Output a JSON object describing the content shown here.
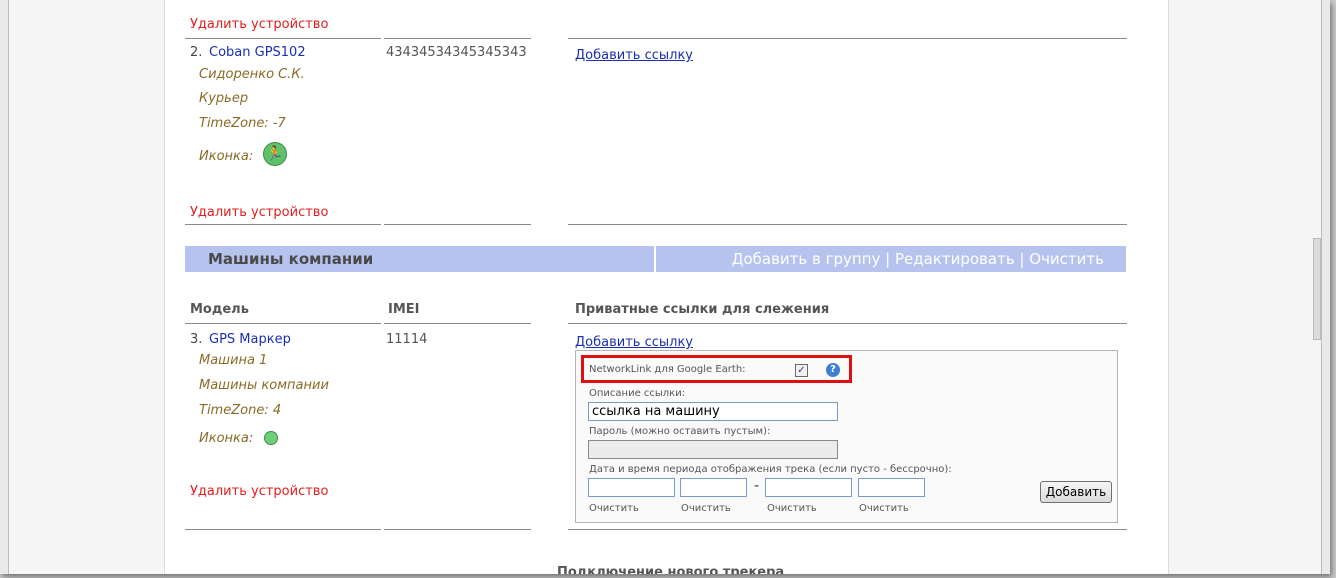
{
  "device_prev": {
    "delete_label_top": "Удалить устройство",
    "index": "2.",
    "model": "Coban GPS102",
    "imei": "43434534345345343",
    "owner": "Сидоренко С.К.",
    "group": "Курьер",
    "timezone": "TimeZone: -7",
    "icon_label": "Иконка:",
    "icon_name": "runner-icon",
    "add_link": "Добавить ссылку",
    "delete_label": "Удалить устройство"
  },
  "group_bar": {
    "title": "Машины компании",
    "actions": "Добавить в группу | Редактировать | Очистить"
  },
  "columns": {
    "model": "Модель",
    "imei": "IMEI",
    "links": "Приватные ссылки для слежения"
  },
  "device": {
    "index": "3.",
    "model": "GPS Маркер",
    "imei": "11114",
    "owner": "Машина 1",
    "group": "Машины компании",
    "timezone": "TimeZone: 4",
    "icon_label": "Иконка:",
    "icon_name": "green-dot-icon",
    "add_link": "Добавить ссылку",
    "delete_label": "Удалить устройство"
  },
  "link_form": {
    "networklink_label": "NetworkLink для Google Earth:",
    "networklink_checked": true,
    "help_icon": "help-icon",
    "description_label": "Описание ссылки:",
    "description_value": "ссылка на машину",
    "password_label": "Пароль (можно оставить пустым):",
    "password_value": "",
    "period_label": "Дата и время периода отображения трека (если пусто - бессрочно):",
    "dash": "-",
    "clear_labels": [
      "Очистить",
      "Очистить",
      "Очистить",
      "Очистить"
    ],
    "add_button": "Добавить"
  },
  "footer": {
    "new_tracker": "Подключение нового трекера"
  }
}
